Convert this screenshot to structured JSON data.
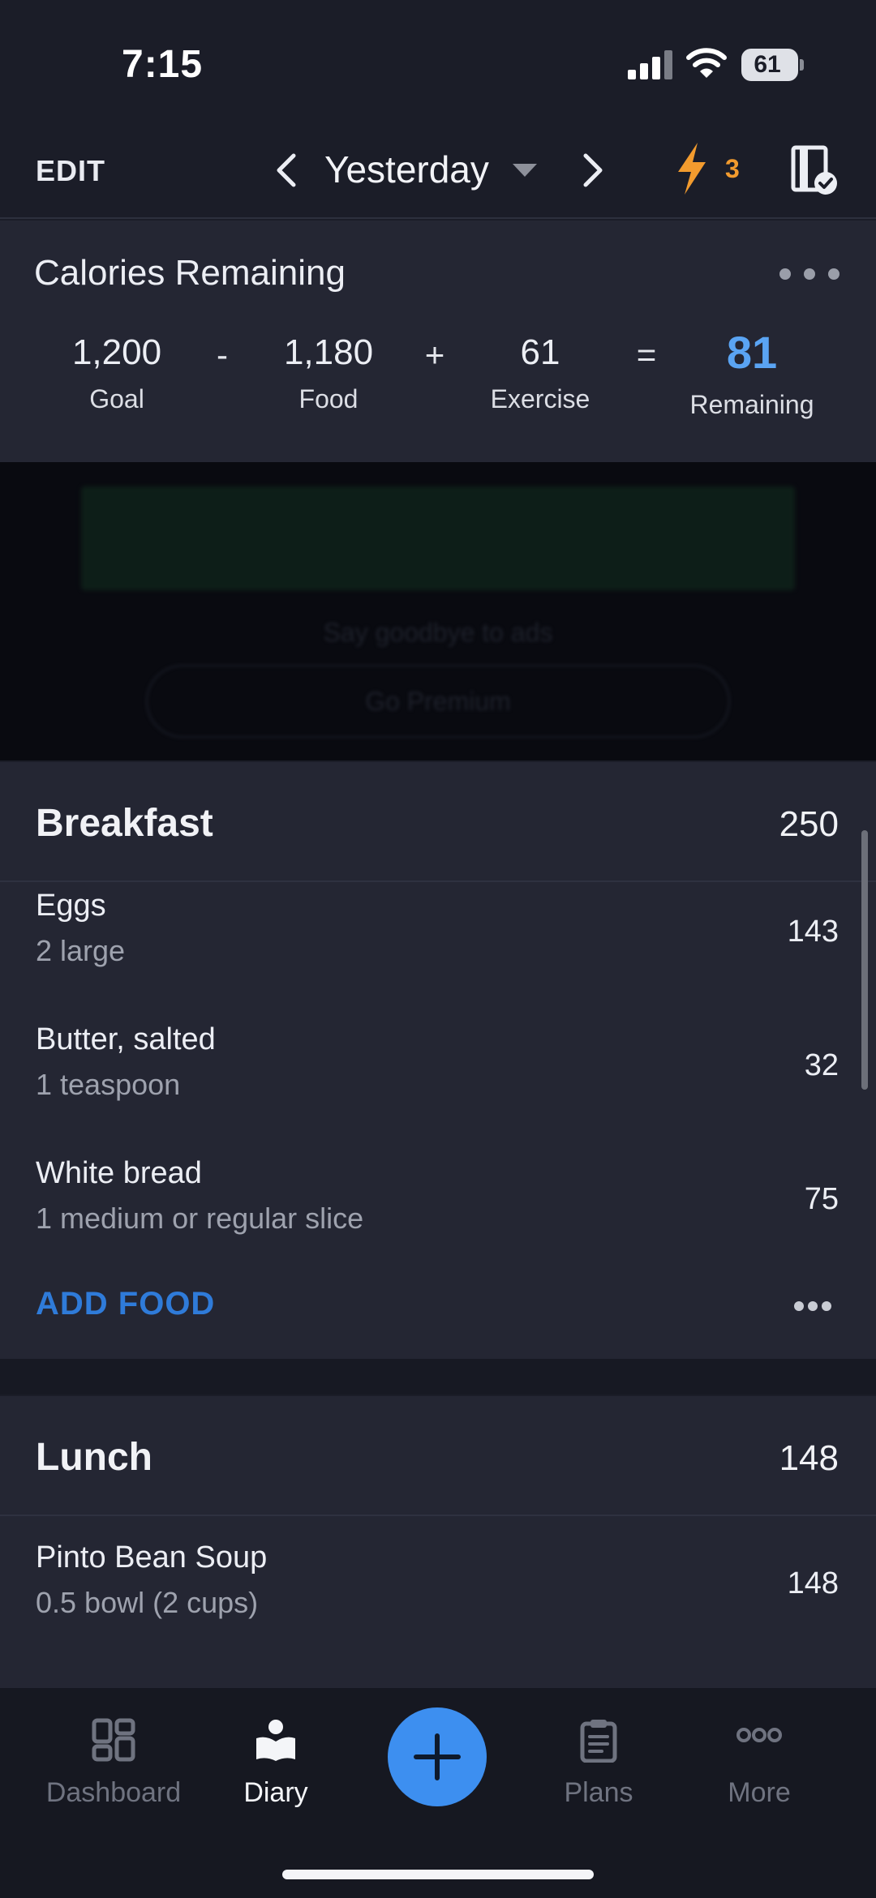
{
  "status_bar": {
    "time": "7:15",
    "battery": "61"
  },
  "header": {
    "edit_label": "EDIT",
    "date": "Yesterday",
    "streak_count": "3"
  },
  "calories": {
    "title": "Calories Remaining",
    "goal": {
      "value": "1,200",
      "label": "Goal"
    },
    "food": {
      "value": "1,180",
      "label": "Food"
    },
    "exercise": {
      "value": "61",
      "label": "Exercise"
    },
    "remaining": {
      "value": "81",
      "label": "Remaining"
    },
    "op_minus": "-",
    "op_plus": "+",
    "op_equals": "="
  },
  "ad": {
    "tagline": "Say goodbye to ads",
    "button": "Go Premium"
  },
  "meals": {
    "breakfast": {
      "title": "Breakfast",
      "total": "250",
      "items": [
        {
          "name": "Eggs",
          "serving": "2 large",
          "calories": "143"
        },
        {
          "name": "Butter, salted",
          "serving": "1 teaspoon",
          "calories": "32"
        },
        {
          "name": "White bread",
          "serving": "1 medium or regular slice",
          "calories": "75"
        }
      ],
      "add_food": "ADD FOOD"
    },
    "lunch": {
      "title": "Lunch",
      "total": "148",
      "items": [
        {
          "name": "Pinto Bean Soup",
          "serving": "0.5 bowl (2 cups)",
          "calories": "148"
        }
      ]
    }
  },
  "tabbar": {
    "tabs": [
      {
        "label": "Dashboard",
        "icon": "dashboard-icon"
      },
      {
        "label": "Diary",
        "icon": "diary-icon",
        "active": true
      },
      {
        "label": "Plans",
        "icon": "clipboard-icon"
      },
      {
        "label": "More",
        "icon": "more-icon"
      }
    ],
    "add_icon": "plus-icon"
  },
  "colors": {
    "accent": "#3d8ff0",
    "remaining": "#5aa4f3",
    "streak": "#f29b2e",
    "add_food": "#2f7bd9"
  }
}
